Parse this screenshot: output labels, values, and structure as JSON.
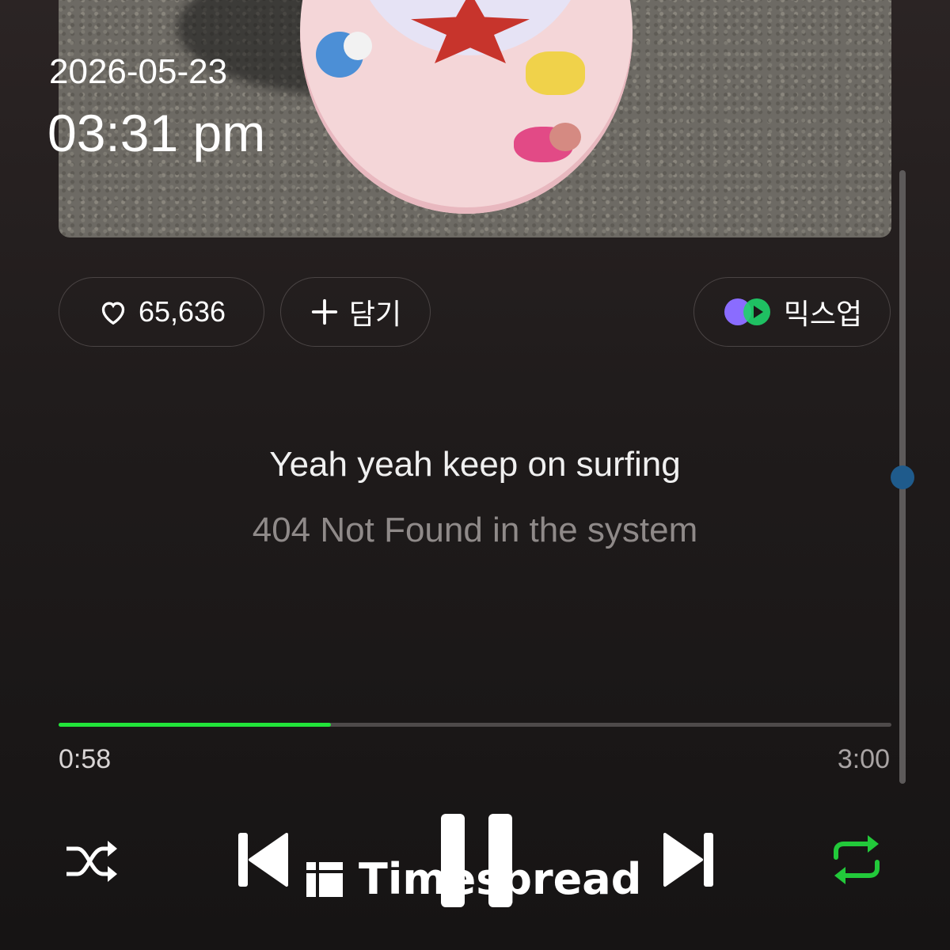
{
  "status": {
    "date": "2026-05-23",
    "time": "03:31 pm"
  },
  "actions": {
    "like_count": "65,636",
    "add_label": "담기",
    "mixup_label": "믹스업"
  },
  "lyrics": {
    "current": "Yeah yeah keep on surfing",
    "next": "404 Not Found in the system"
  },
  "player": {
    "elapsed": "0:58",
    "duration": "3:00",
    "progress_fraction": 0.327,
    "accent_color": "#22e43a",
    "repeat_active": true
  },
  "controls": [
    "shuffle-icon",
    "previous-icon",
    "pause-icon",
    "next-icon",
    "repeat-icon"
  ],
  "watermark": {
    "text": "Timespread"
  }
}
